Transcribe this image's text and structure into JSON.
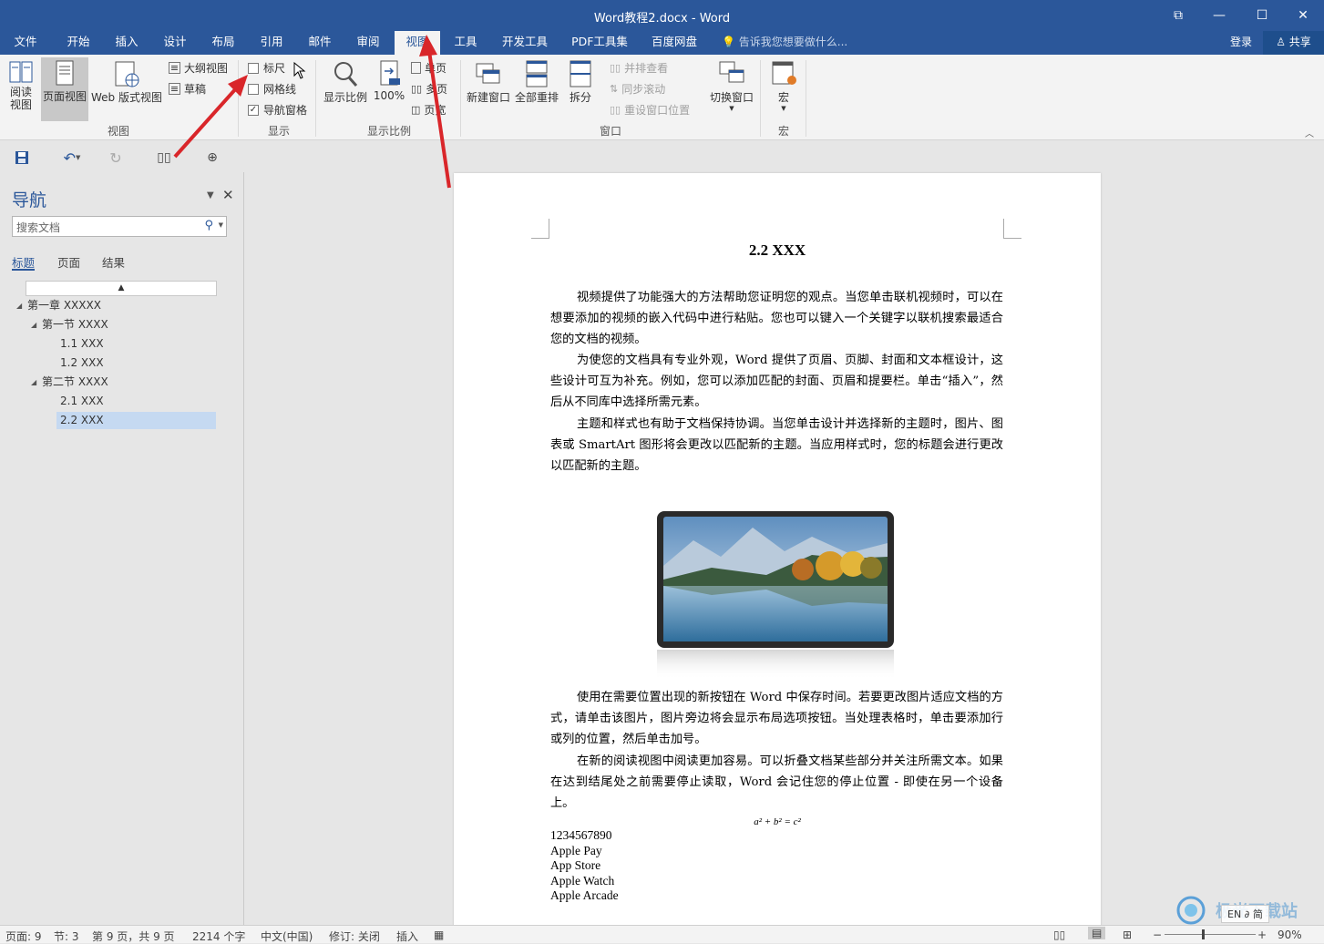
{
  "window": {
    "title": "Word教程2.docx - Word",
    "controls": {
      "restore_glyph": "⧉",
      "minimize_glyph": "—",
      "maximize_glyph": "☐",
      "close_glyph": "✕"
    }
  },
  "tabs": [
    {
      "label": "文件"
    },
    {
      "label": "开始"
    },
    {
      "label": "插入"
    },
    {
      "label": "设计"
    },
    {
      "label": "布局"
    },
    {
      "label": "引用"
    },
    {
      "label": "邮件"
    },
    {
      "label": "审阅"
    },
    {
      "label": "视图",
      "active": true
    },
    {
      "label": "工具"
    },
    {
      "label": "开发工具"
    },
    {
      "label": "PDF工具集"
    },
    {
      "label": "百度网盘"
    }
  ],
  "tell_me": "告诉我您想要做什么...",
  "login": "登录",
  "share": "共享",
  "ribbon": {
    "views": {
      "read_mode": "阅读\n视图",
      "print_layout": "页面视图",
      "web_layout": "Web 版式视图",
      "outline": "大纲视图",
      "draft": "草稿",
      "label": "视图"
    },
    "show": {
      "ruler": "标尺",
      "gridlines": "网格线",
      "nav_pane": "导航窗格",
      "ruler_checked": false,
      "gridlines_checked": false,
      "nav_pane_checked": true,
      "label": "显示"
    },
    "zoom": {
      "zoom": "显示比例",
      "hundred": "100%",
      "one_page": "单页",
      "multi_page": "多页",
      "page_width": "页宽",
      "label": "显示比例"
    },
    "window": {
      "new_window": "新建窗口",
      "arrange_all": "全部重排",
      "split": "拆分",
      "side_by_side": "并排查看",
      "sync_scroll": "同步滚动",
      "reset_position": "重设窗口位置",
      "switch_windows": "切换窗口",
      "label": "窗口"
    },
    "macros": {
      "macros": "宏",
      "label": "宏"
    }
  },
  "nav_pane": {
    "title": "导航",
    "search_placeholder": "搜索文档",
    "tabs": [
      "标题",
      "页面",
      "结果"
    ],
    "tree": [
      {
        "label": "第一章 XXXXX",
        "level": 0,
        "expanded": true
      },
      {
        "label": "第一节 XXXX",
        "level": 1,
        "expanded": true
      },
      {
        "label": "1.1 XXX",
        "level": 2
      },
      {
        "label": "1.2 XXX",
        "level": 2
      },
      {
        "label": "第二节 XXXX",
        "level": 1,
        "expanded": true
      },
      {
        "label": "2.1 XXX",
        "level": 2
      },
      {
        "label": "2.2 XXX",
        "level": 2,
        "selected": true
      }
    ]
  },
  "document": {
    "heading": "2.2 XXX",
    "paragraphs": [
      "视频提供了功能强大的方法帮助您证明您的观点。当您单击联机视频时，可以在想要添加的视频的嵌入代码中进行粘贴。您也可以键入一个关键字以联机搜索最适合您的文档的视频。",
      "为使您的文档具有专业外观，Word 提供了页眉、页脚、封面和文本框设计，这些设计可互为补充。例如，您可以添加匹配的封面、页眉和提要栏。单击“插入”，然后从不同库中选择所需元素。",
      "主题和样式也有助于文档保持协调。当您单击设计并选择新的主题时，图片、图表或 SmartArt 图形将会更改以匹配新的主题。当应用样式时，您的标题会进行更改以匹配新的主题。",
      "使用在需要位置出现的新按钮在 Word 中保存时间。若要更改图片适应文档的方式，请单击该图片，图片旁边将会显示布局选项按钮。当处理表格时，单击要添加行或列的位置，然后单击加号。",
      "在新的阅读视图中阅读更加容易。可以折叠文档某些部分并关注所需文本。如果在达到结尾处之前需要停止读取，Word 会记住您的停止位置 - 即使在另一个设备上。"
    ],
    "formula": "a² + b² = c²",
    "lines": [
      "1234567890",
      "Apple Pay",
      "App Store",
      "Apple Watch",
      "Apple Arcade"
    ]
  },
  "status_bar": {
    "page": "页面: 9",
    "section": "节: 3",
    "page_of": "第 9 页，共 9 页",
    "words": "2214 个字",
    "language": "中文(中国)",
    "track_changes": "修订: 关闭",
    "insert_mode": "插入",
    "zoom_level": "90%",
    "ime": "EN ∂ 简"
  },
  "watermark": "极光下载站",
  "colors": {
    "accent": "#2b579a",
    "annotation_arrow": "#d9262a",
    "selected_tree": "#c5d9f1"
  }
}
